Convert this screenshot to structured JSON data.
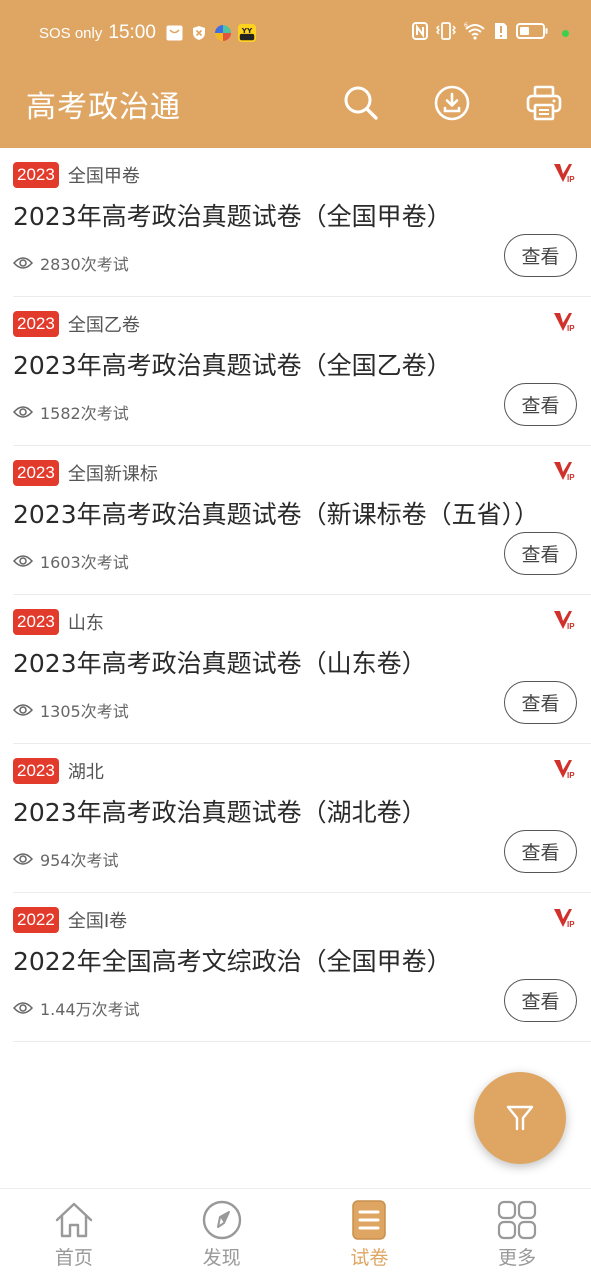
{
  "status_bar": {
    "carrier": "SOS only",
    "time": "15:00",
    "notification_icons": [
      "mail-icon",
      "shield-x-icon",
      "colorful-app-icon",
      "yy-app-icon"
    ],
    "system_icons": [
      "nfc-icon",
      "vibrate-icon",
      "wifi-icon",
      "sim-alert-icon",
      "battery-icon"
    ]
  },
  "header": {
    "title": "高考政治通",
    "actions": [
      "search-icon",
      "download-icon",
      "print-icon"
    ]
  },
  "colors": {
    "brand": "#dfa663",
    "badge": "#e23a2b",
    "vip": "#d0312a"
  },
  "papers": [
    {
      "year": "2023",
      "region": "全国甲卷",
      "title": "2023年高考政治真题试卷（全国甲卷）",
      "count": "2830次考试",
      "vip": true,
      "button": "查看"
    },
    {
      "year": "2023",
      "region": "全国乙卷",
      "title": "2023年高考政治真题试卷（全国乙卷）",
      "count": "1582次考试",
      "vip": true,
      "button": "查看"
    },
    {
      "year": "2023",
      "region": "全国新课标",
      "title": "2023年高考政治真题试卷（新课标卷（五省））",
      "count": "1603次考试",
      "vip": true,
      "button": "查看"
    },
    {
      "year": "2023",
      "region": "山东",
      "title": "2023年高考政治真题试卷（山东卷）",
      "count": "1305次考试",
      "vip": true,
      "button": "查看"
    },
    {
      "year": "2023",
      "region": "湖北",
      "title": "2023年高考政治真题试卷（湖北卷）",
      "count": "954次考试",
      "vip": true,
      "button": "查看"
    },
    {
      "year": "2022",
      "region": "全国I卷",
      "title": "2022年全国高考文综政治（全国甲卷）",
      "count": "1.44万次考试",
      "vip": true,
      "button": "查看"
    }
  ],
  "fab": {
    "icon": "filter-icon"
  },
  "bottom_nav": [
    {
      "label": "首页",
      "icon": "home-icon",
      "active": false
    },
    {
      "label": "发现",
      "icon": "compass-icon",
      "active": false
    },
    {
      "label": "试卷",
      "icon": "paper-icon",
      "active": true
    },
    {
      "label": "更多",
      "icon": "grid-icon",
      "active": false
    }
  ]
}
